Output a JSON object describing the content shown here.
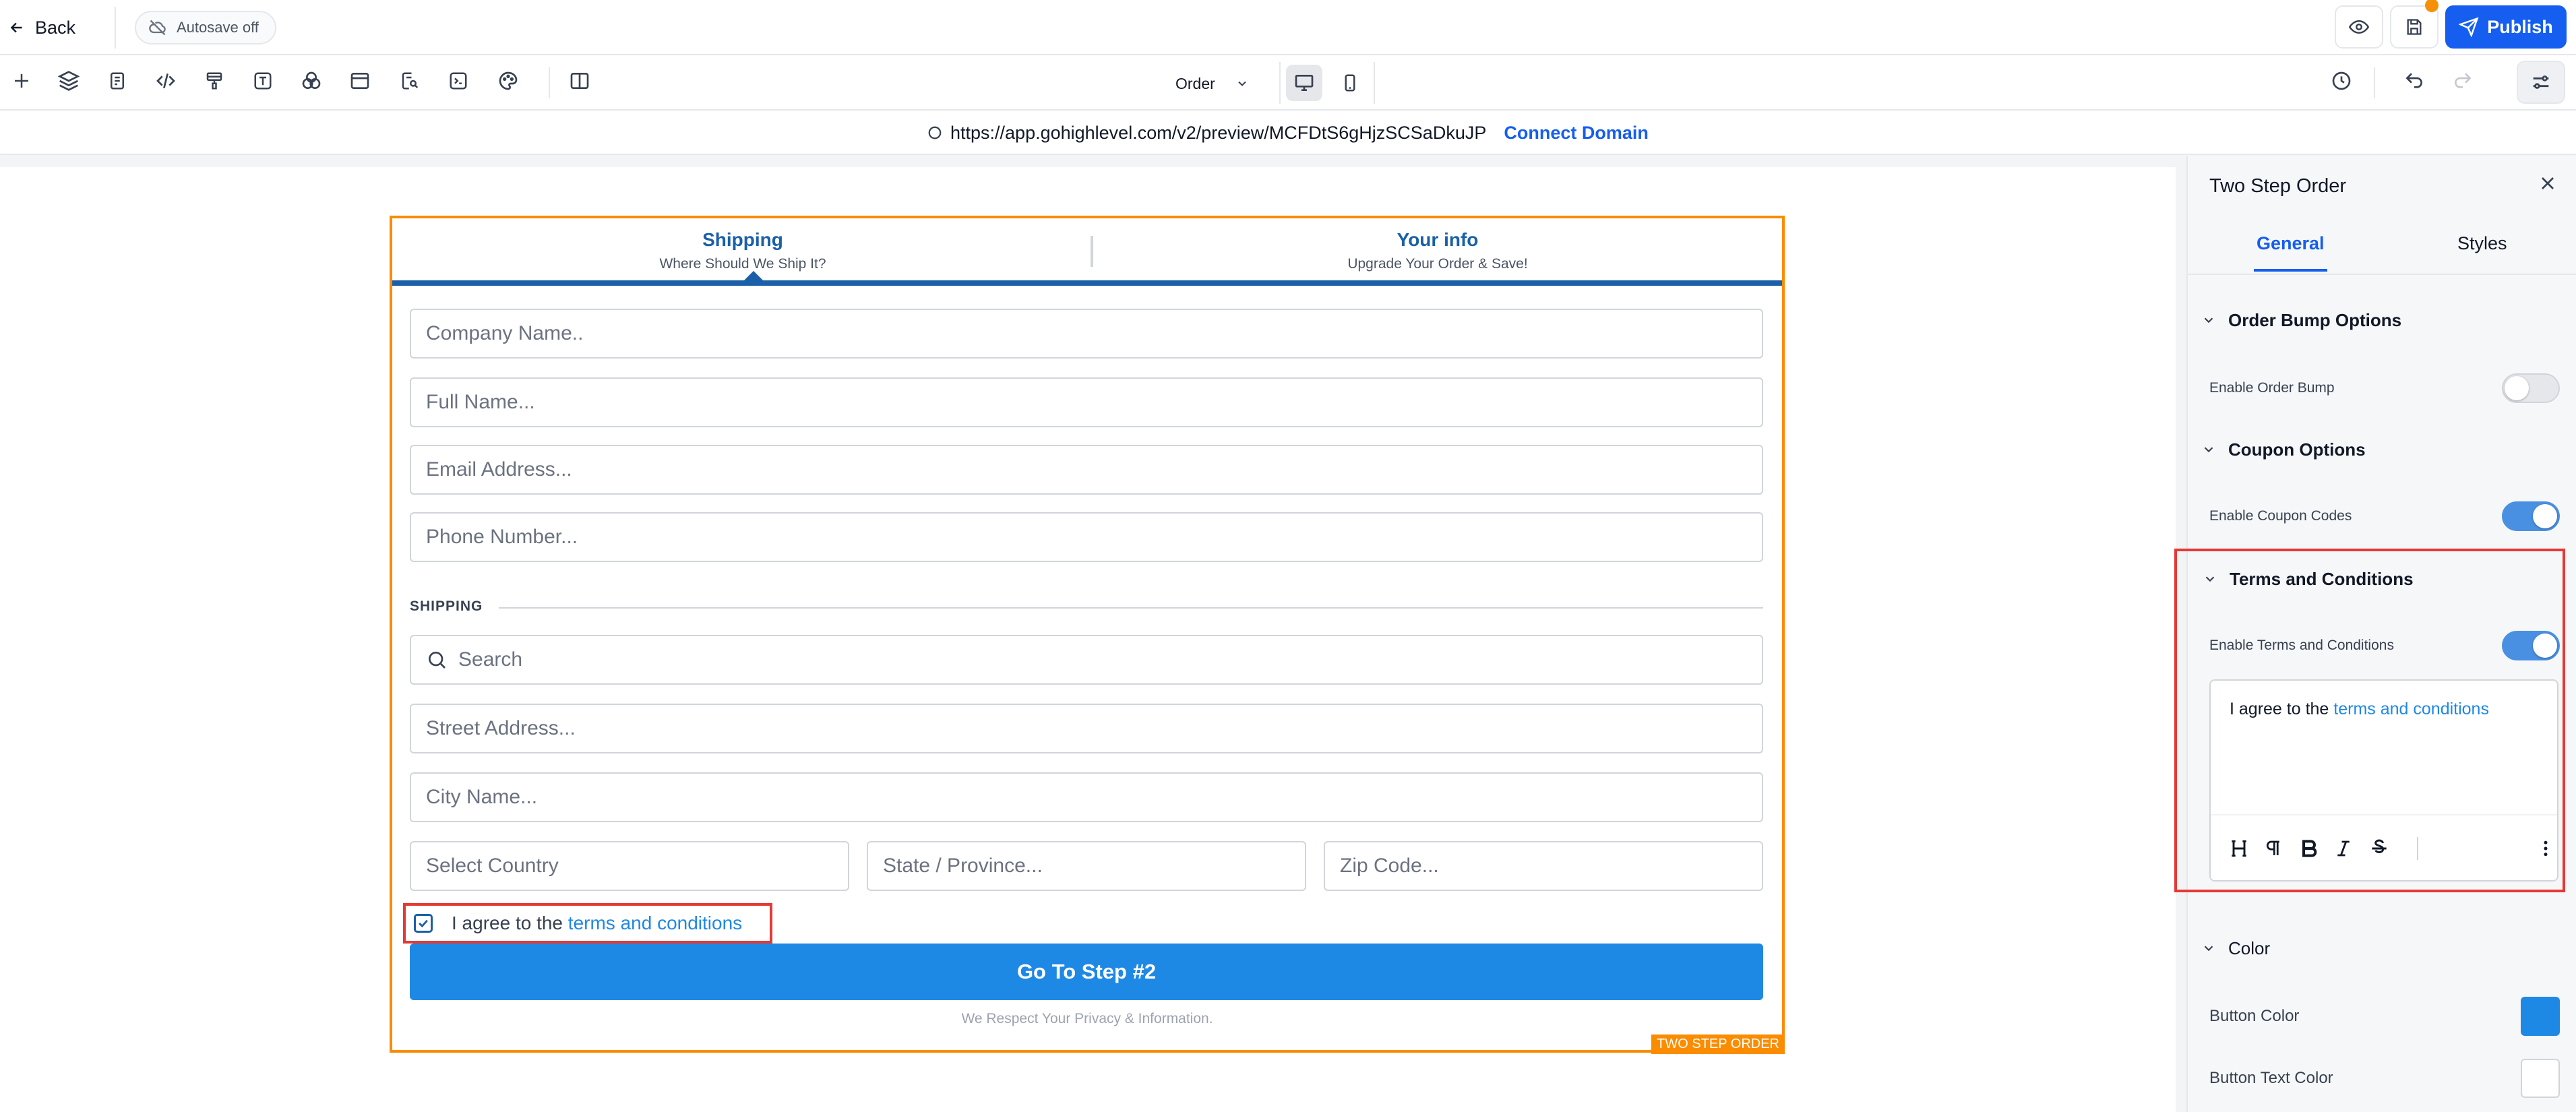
{
  "topbar": {
    "back_label": "Back",
    "autosave_label": "Autosave off",
    "publish_label": "Publish"
  },
  "toolbar": {
    "page_selector": "Order"
  },
  "urlbar": {
    "url": "https://app.gohighlevel.com/v2/preview/MCFDtS6gHjzSCSaDkuJP",
    "connect_label": "Connect Domain"
  },
  "form": {
    "tab1_title": "Shipping",
    "tab1_sub": "Where Should We Ship It?",
    "tab2_title": "Your info",
    "tab2_sub": "Upgrade Your Order & Save!",
    "fields": {
      "company": "Company Name..",
      "fullname": "Full Name...",
      "email": "Email Address...",
      "phone": "Phone Number...",
      "search": "Search",
      "street": "Street Address...",
      "city": "City Name...",
      "country": "Select Country",
      "state": "State / Province...",
      "zip": "Zip Code..."
    },
    "shipping_label": "SHIPPING",
    "terms_prefix": "I agree to the",
    "terms_link": "terms and conditions",
    "submit_label": "Go To Step #2",
    "privacy": "We Respect Your Privacy & Information.",
    "badge": "TWO STEP ORDER"
  },
  "panel": {
    "title": "Two Step Order",
    "tab_general": "General",
    "tab_styles": "Styles",
    "sec_orderbump": "Order Bump Options",
    "enable_orderbump": "Enable Order Bump",
    "sec_coupon": "Coupon Options",
    "enable_coupon": "Enable Coupon Codes",
    "sec_terms": "Terms and Conditions",
    "enable_terms": "Enable Terms and Conditions",
    "editor_prefix": "I agree to the",
    "editor_link": "terms and conditions",
    "sec_color": "Color",
    "button_color": "Button Color",
    "button_text_color": "Button Text Color"
  },
  "toggles": {
    "order_bump": false,
    "coupon": true,
    "terms": true
  },
  "colors": {
    "accent": "#155eef",
    "button": "#1e88e5",
    "form_border": "#fb8c00",
    "highlight": "#e53935",
    "tab_blue": "#1a5fa8"
  }
}
